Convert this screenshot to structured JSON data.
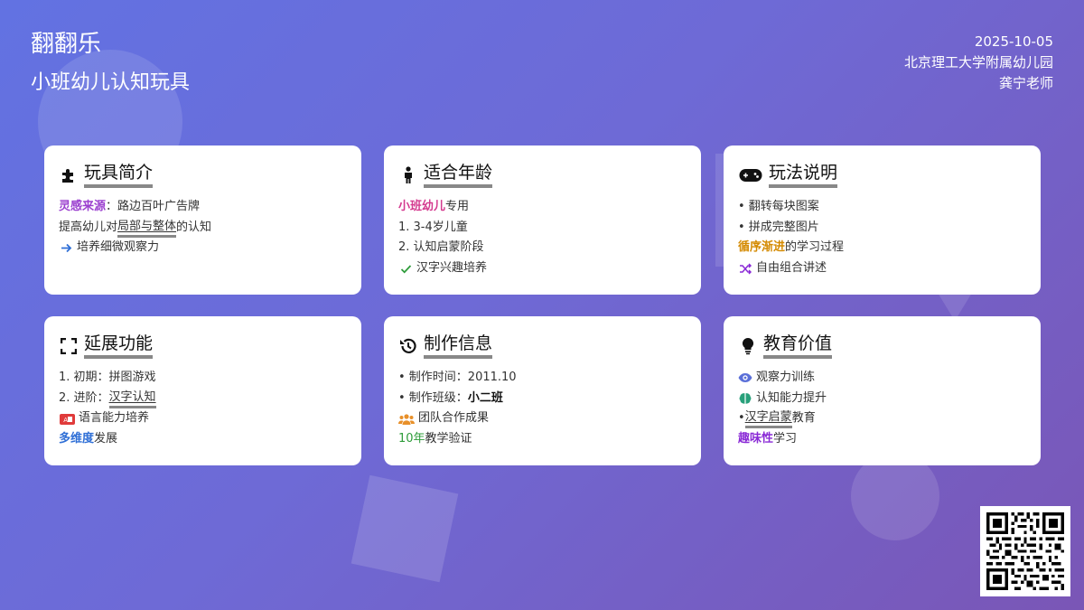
{
  "header": {
    "title": "翻翻乐",
    "subtitle": "小班幼儿认知玩具",
    "date": "2025-10-05",
    "school": "北京理工大学附属幼儿园",
    "teacher": "龚宁老师"
  },
  "cards": [
    {
      "title": "玩具简介",
      "icon": "puzzle-icon",
      "lines": {
        "l1_hl": "灵感来源",
        "l1_rest": "：路边百叶广告牌",
        "l2_pre": "提高幼儿对",
        "l2_hl": "局部与整体",
        "l2_post": "的认知",
        "l3": "培养细微观察力"
      }
    },
    {
      "title": "适合年龄",
      "icon": "child-icon",
      "lines": {
        "l1_hl": "小班幼儿",
        "l1_rest": "专用",
        "l2": "1. 3-4岁儿童",
        "l3": "2. 认知启蒙阶段",
        "l4": "汉字兴趣培养"
      }
    },
    {
      "title": "玩法说明",
      "icon": "gamepad-icon",
      "lines": {
        "l1": "• 翻转每块图案",
        "l2": "• 拼成完整图片",
        "l3_hl": "循序渐进",
        "l3_rest": "的学习过程",
        "l4": "自由组合讲述"
      }
    },
    {
      "title": "延展功能",
      "icon": "expand-icon",
      "lines": {
        "l1": "1. 初期：拼图游戏",
        "l2_pre": "2. 进阶：",
        "l2_hl": "汉字认知",
        "l3": "语言能力培养",
        "l4_hl": "多维度",
        "l4_rest": "发展"
      }
    },
    {
      "title": "制作信息",
      "icon": "history-icon",
      "lines": {
        "l1": "• 制作时间：2011.10",
        "l2_pre": "• 制作班级：",
        "l2_hl": "小二班",
        "l3": "团队合作成果",
        "l4_hl": "10年",
        "l4_rest": "教学验证"
      }
    },
    {
      "title": "教育价值",
      "icon": "lightbulb-icon",
      "lines": {
        "l1": "观察力训练",
        "l2": "认知能力提升",
        "l3_pre": "• ",
        "l3_hl": "汉字启蒙",
        "l3_post": "教育",
        "l4_hl": "趣味性",
        "l4_rest": "学习"
      }
    }
  ],
  "colors": {
    "bg_start": "#6272e2",
    "bg_end": "#7a56b6",
    "purple": "#9b3fcf",
    "pink": "#d43a8f",
    "orange": "#d48a00",
    "blue": "#2f6fd6",
    "green": "#2e9c3a"
  }
}
